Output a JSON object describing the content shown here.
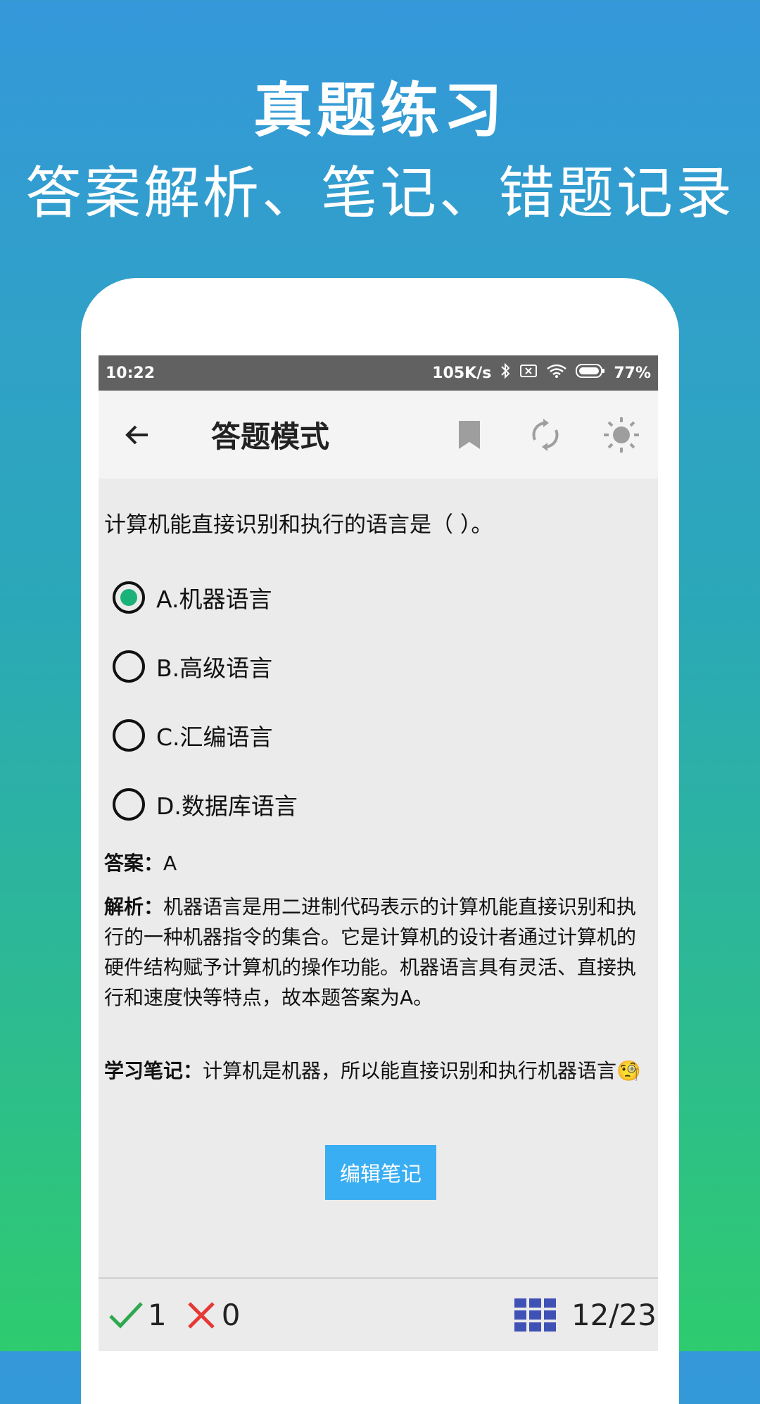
{
  "promo": {
    "title": "真题练习",
    "subtitle": "答案解析、笔记、错题记录"
  },
  "statusbar": {
    "time": "10:22",
    "speed": "105K/s",
    "battery": "77%"
  },
  "appbar": {
    "title": "答题模式",
    "icons": [
      "arrow-back-icon",
      "bookmark-icon",
      "sync-icon",
      "brightness-icon"
    ]
  },
  "question": {
    "text": "计算机能直接识别和执行的语言是（ ）。",
    "options": [
      {
        "label": "A.机器语言",
        "selected": true
      },
      {
        "label": "B.高级语言",
        "selected": false
      },
      {
        "label": "C.汇编语言",
        "selected": false
      },
      {
        "label": "D.数据库语言",
        "selected": false
      }
    ]
  },
  "answer": {
    "label": "答案：",
    "value": "A"
  },
  "analysis": {
    "label": "解析：",
    "text": "机器语言是用二进制代码表示的计算机能直接识别和执行的一种机器指令的集合。它是计算机的设计者通过计算机的硬件结构赋予计算机的操作功能。机器语言具有灵活、直接执行和速度快等特点，故本题答案为A。"
  },
  "note": {
    "label": "学习笔记：",
    "text": "计算机是机器，所以能直接识别和执行机器语言🧐"
  },
  "edit_button": "编辑笔记",
  "bottombar": {
    "correct_count": "1",
    "wrong_count": "0",
    "progress": "12/23"
  },
  "colors": {
    "selected_radio": "#1bb27a",
    "button": "#3aaef2",
    "correct": "#2ea84f",
    "wrong": "#e53935",
    "grid": "#3f51b5"
  }
}
